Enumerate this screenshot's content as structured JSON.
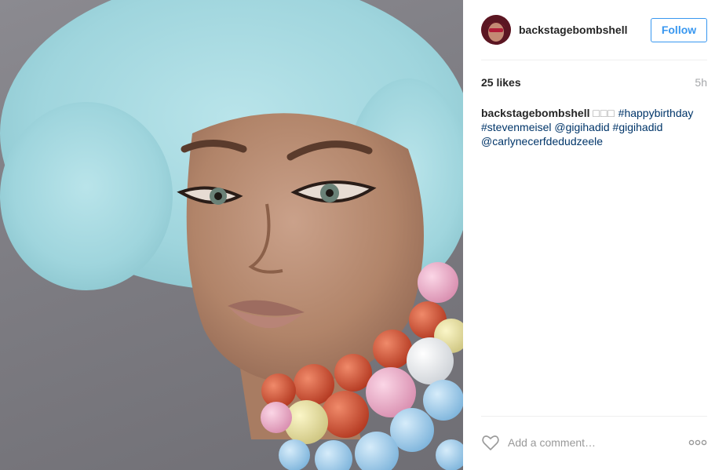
{
  "post": {
    "username": "backstagebombshell",
    "follow_label": "Follow",
    "likes": "25 likes",
    "time": "5h",
    "caption": {
      "username": "backstagebombshell",
      "boxes": "□□□",
      "tags": [
        "#happybirthday",
        "#stevenmeisel",
        "@gigihadid",
        "#gigihadid",
        "@carlynecerfdedudzeele"
      ]
    },
    "comment_placeholder": "Add a comment…"
  },
  "colors": {
    "accent": "#3897f0",
    "link": "#003569",
    "muted": "#a5a7aa"
  },
  "icons": {
    "like": "heart-outline-icon",
    "more": "ellipsis-icon"
  }
}
